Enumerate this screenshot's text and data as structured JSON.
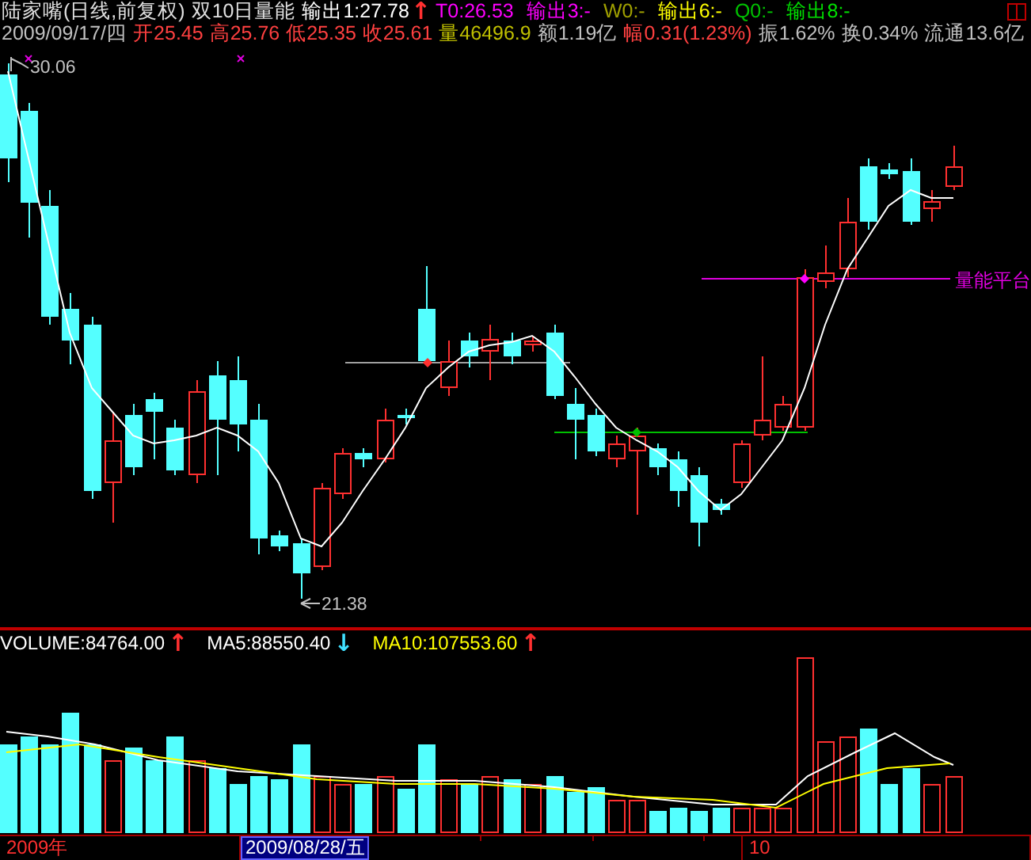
{
  "header": {
    "title": "陆家嘴(日线,前复权)",
    "indicator": "双10日量能",
    "outputs": [
      {
        "label": "输出1:27.78",
        "color": "#ffffff",
        "arrow": {
          "glyph": "↑",
          "color": "#ff3030"
        }
      },
      {
        "label": "T0:26.53",
        "color": "#ff00ff"
      },
      {
        "label": "输出3:-",
        "color": "#ff00ff"
      },
      {
        "label": "W0:-",
        "color": "#a0a000"
      },
      {
        "label": "输出6:-",
        "color": "#ffff00"
      },
      {
        "label": "Q0:-",
        "color": "#00c000"
      },
      {
        "label": "输出8:-",
        "color": "#00e000"
      }
    ]
  },
  "quote": {
    "date": "2009/09/17/四",
    "fields": [
      {
        "label": "开25.45",
        "color": "#ff4040"
      },
      {
        "label": "高25.76",
        "color": "#ff4040"
      },
      {
        "label": "低25.35",
        "color": "#ff4040"
      },
      {
        "label": "收25.61",
        "color": "#ff4040"
      },
      {
        "label": "量46496.9",
        "color": "#c0c000"
      },
      {
        "label": "额1.19亿",
        "color": "#c0c0c0"
      },
      {
        "label": "幅0.31(1.23%)",
        "color": "#ff4040"
      },
      {
        "label": "振1.62%",
        "color": "#c0c0c0"
      },
      {
        "label": "换0.34%",
        "color": "#c0c0c0"
      },
      {
        "label": "流通13.6亿",
        "color": "#c0c0c0"
      }
    ]
  },
  "price_chart": {
    "high_label": "30.06",
    "low_label": "21.38",
    "platform_label": "量能平台"
  },
  "volume": {
    "readings": [
      {
        "label": "VOLUME:84764.00",
        "color": "#ffffff",
        "arrow": {
          "glyph": "↑",
          "color": "#ff3030"
        }
      },
      {
        "label": "MA5:88550.40",
        "color": "#ffffff",
        "arrow": {
          "glyph": "↓",
          "color": "#40e0ff"
        }
      },
      {
        "label": "MA10:107553.60",
        "color": "#ffff00",
        "arrow": {
          "glyph": "↑",
          "color": "#ff3030"
        }
      }
    ]
  },
  "date_bar": {
    "items": [
      {
        "label": "2009年",
        "selected": false
      },
      {
        "label": "2009/08/28/五",
        "selected": true
      },
      {
        "label": "10",
        "selected": false
      }
    ]
  }
}
